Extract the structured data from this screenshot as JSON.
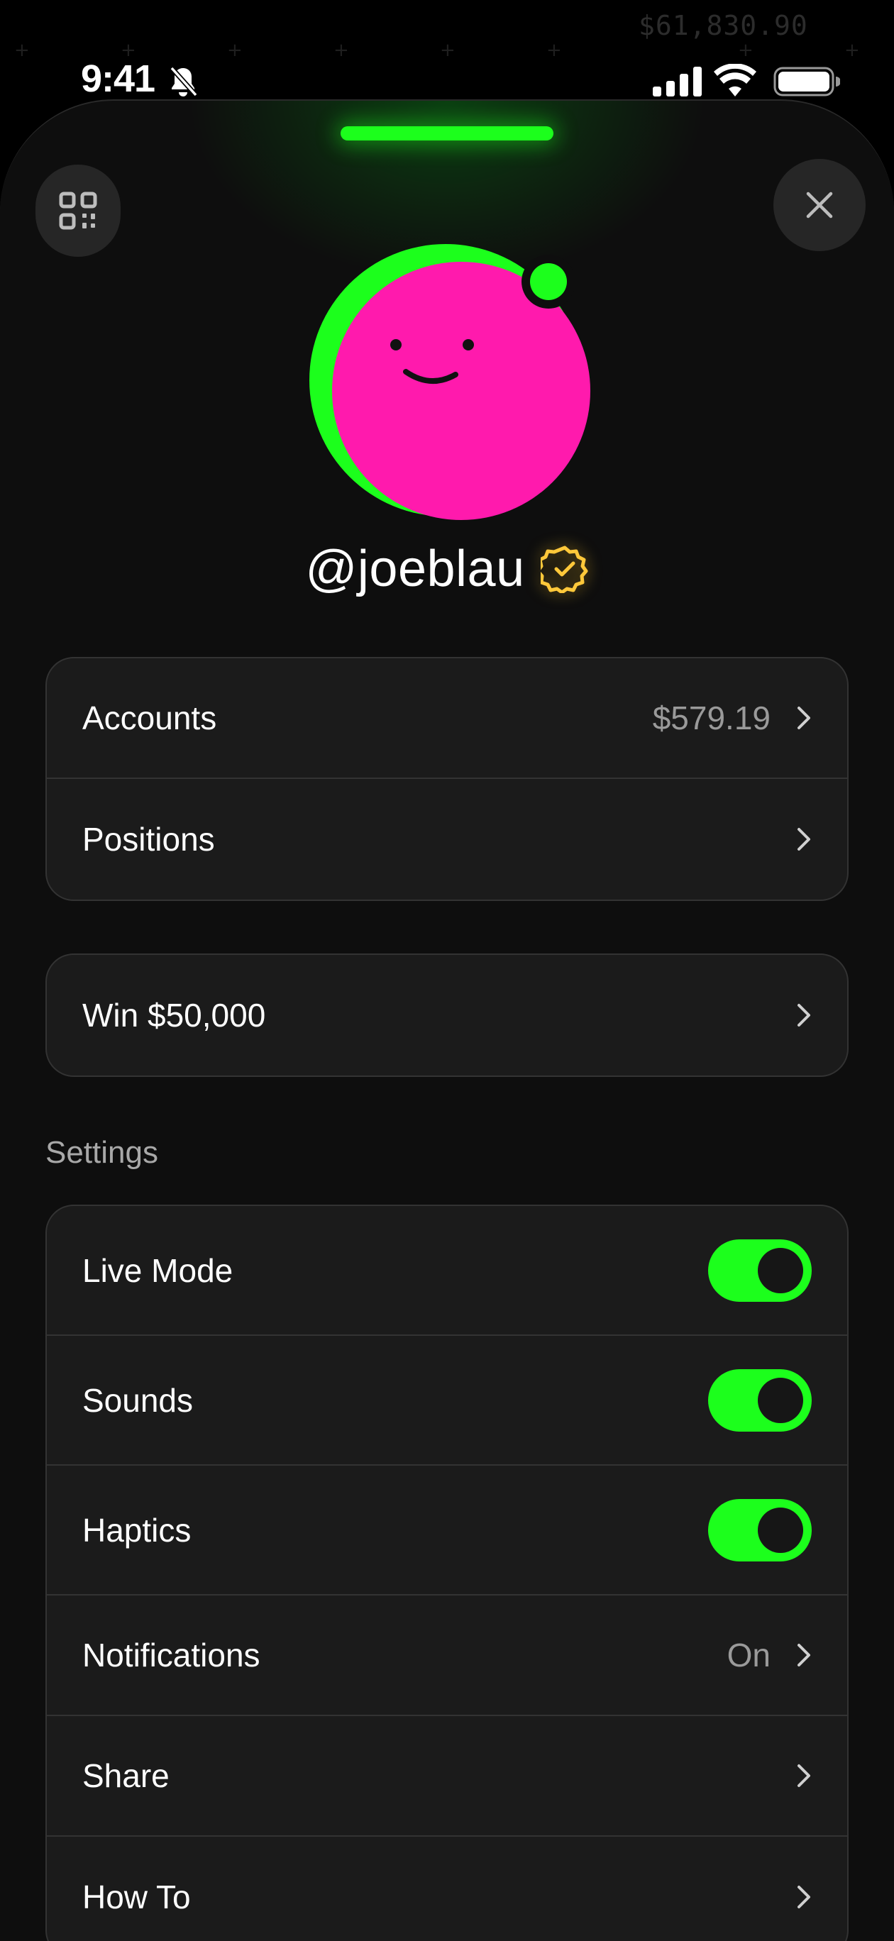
{
  "status_bar": {
    "time": "9:41"
  },
  "background": {
    "ticker_value": "$61,830.90"
  },
  "profile": {
    "username": "@joeblau"
  },
  "account_card": {
    "accounts_label": "Accounts",
    "accounts_value": "$579.19",
    "positions_label": "Positions"
  },
  "promo_card": {
    "label": "Win $50,000"
  },
  "settings": {
    "heading": "Settings",
    "live_mode_label": "Live Mode",
    "live_mode_on": true,
    "sounds_label": "Sounds",
    "sounds_on": true,
    "haptics_label": "Haptics",
    "haptics_on": true,
    "notifications_label": "Notifications",
    "notifications_value": "On",
    "share_label": "Share",
    "howto_label": "How To"
  },
  "colors": {
    "accent_green": "#1cff1c",
    "avatar_pink": "#ff1aad",
    "verified_gold": "#ffc83a"
  }
}
